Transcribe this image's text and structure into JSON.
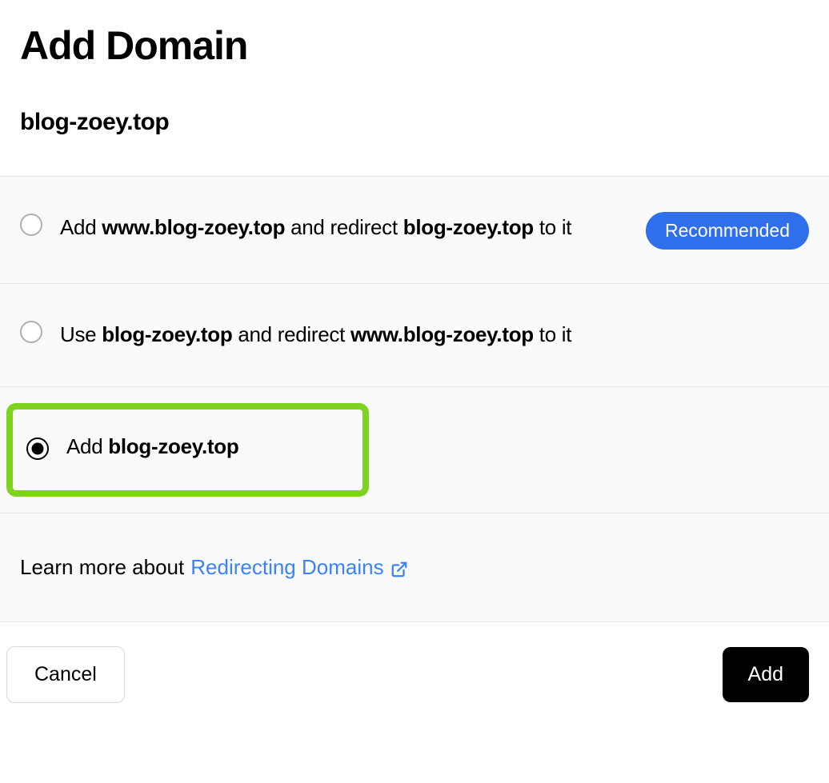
{
  "title": "Add Domain",
  "domain": "blog-zoey.top",
  "options": {
    "opt1": {
      "prefix": "Add ",
      "bold1": "www.blog-zoey.top",
      "mid": " and redirect ",
      "bold2": "blog-zoey.top",
      "suffix": " to it",
      "badge": "Recommended"
    },
    "opt2": {
      "prefix": "Use ",
      "bold1": "blog-zoey.top",
      "mid": " and redirect ",
      "bold2": "www.blog-zoey.top",
      "suffix": " to it"
    },
    "opt3": {
      "prefix": "Add ",
      "bold1": "blog-zoey.top"
    }
  },
  "learn_more": {
    "prefix": "Learn more about ",
    "link_text": "Redirecting Domains"
  },
  "footer": {
    "cancel": "Cancel",
    "add": "Add"
  }
}
